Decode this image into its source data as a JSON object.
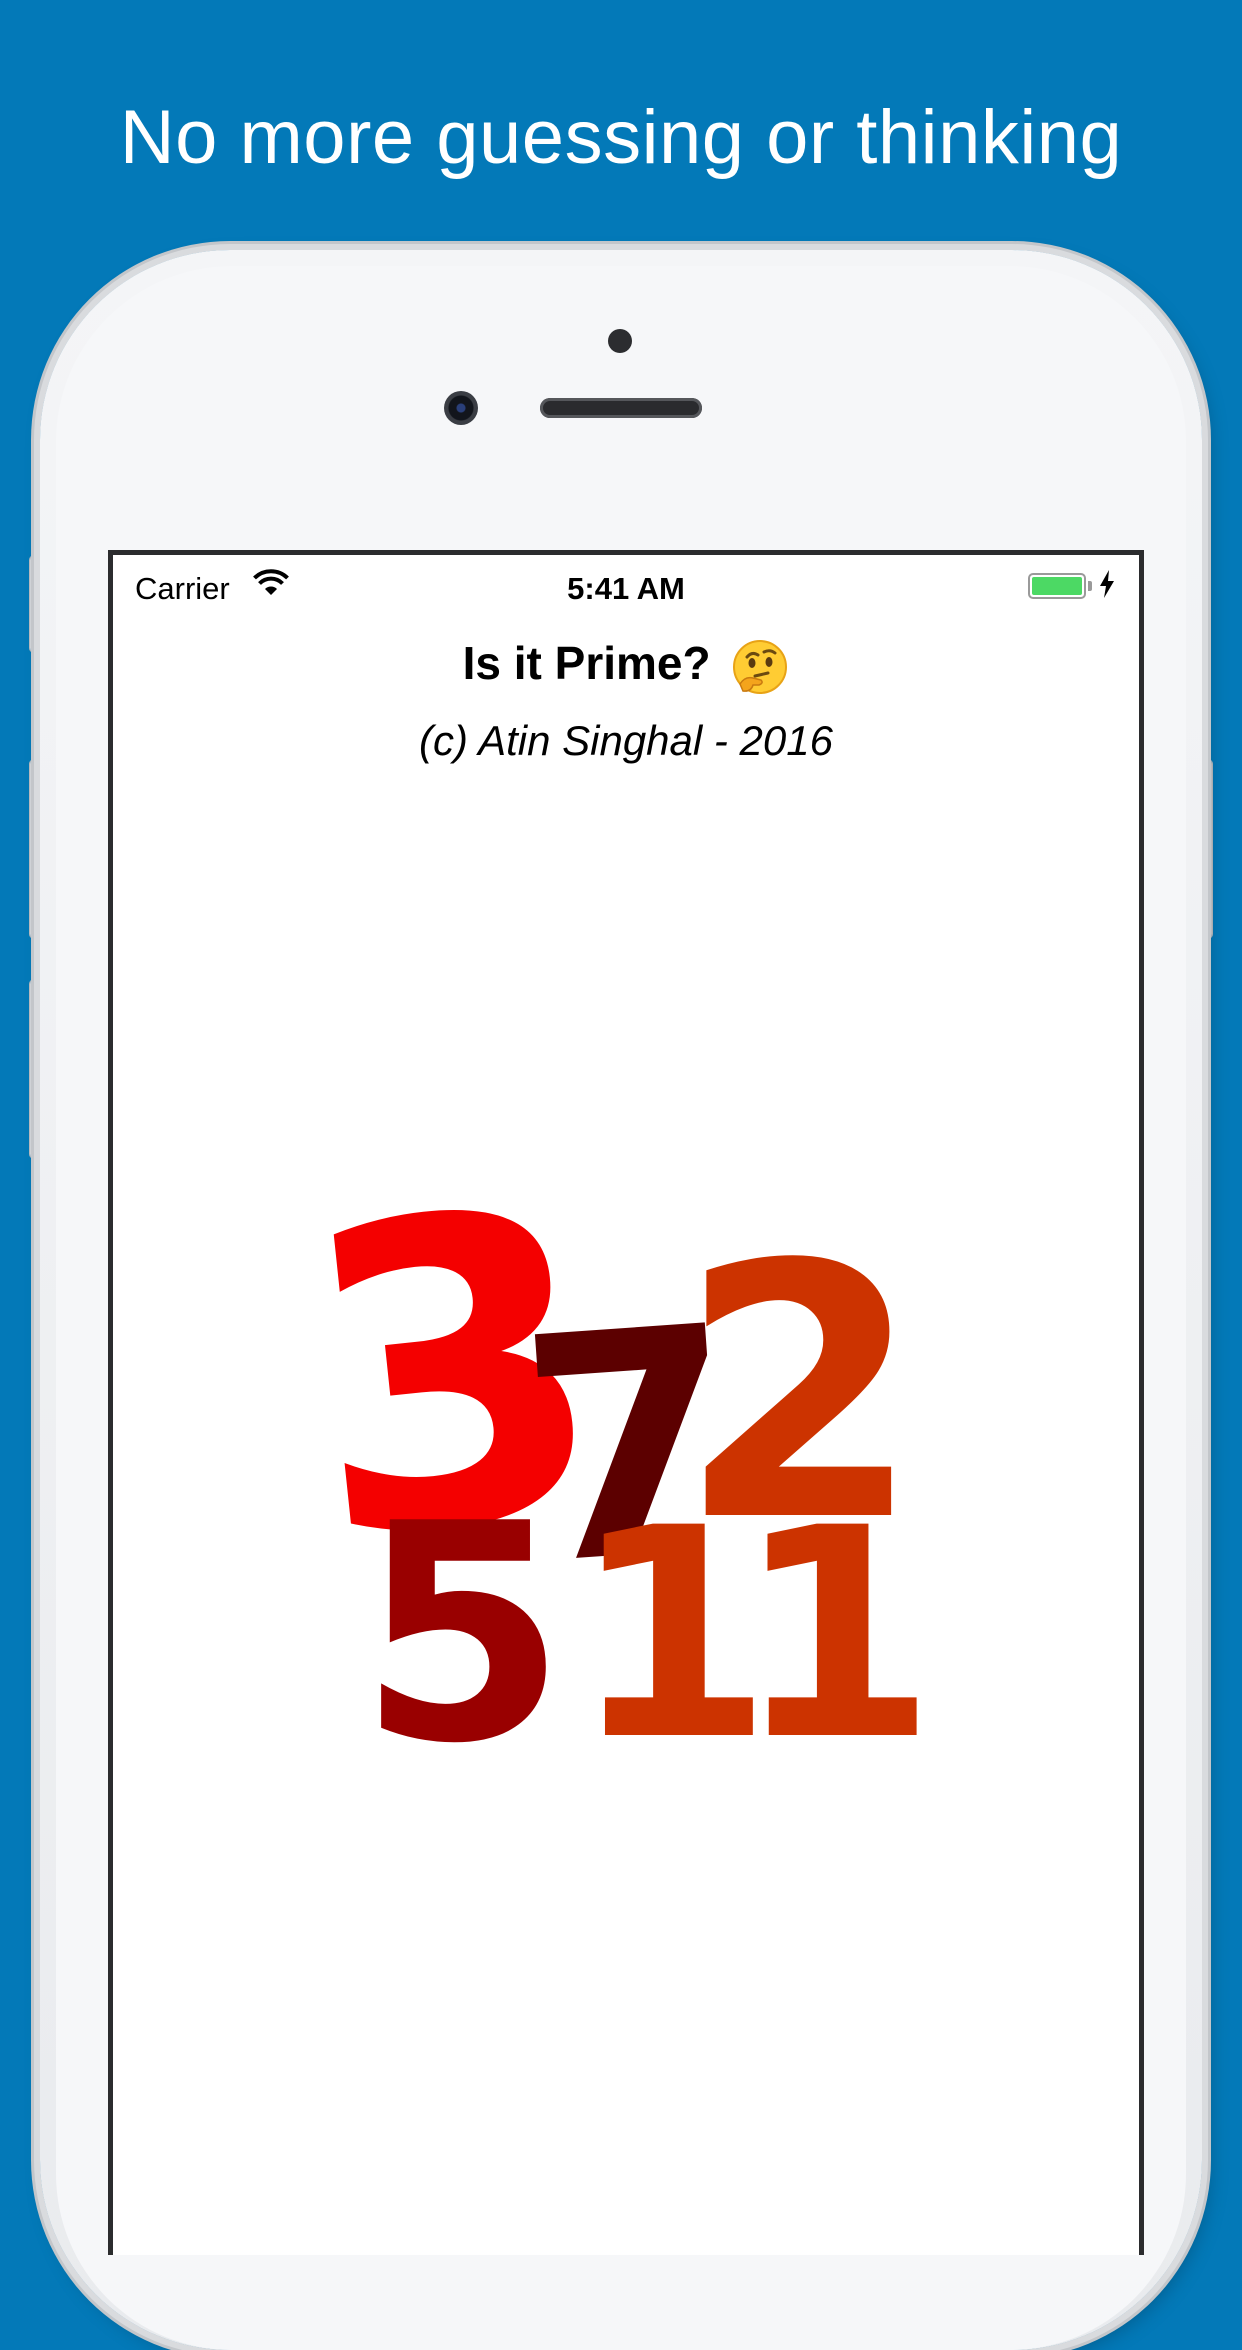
{
  "banner": {
    "headline": "No more guessing or thinking"
  },
  "status_bar": {
    "carrier": "Carrier",
    "time": "5:41 AM"
  },
  "app": {
    "title": "Is it Prime?",
    "title_emoji": "thinking-face-icon",
    "subtitle": "(c) Atin Singhal - 2016"
  },
  "logo": {
    "numbers": [
      {
        "text": "3",
        "color": "#f40000"
      },
      {
        "text": "2",
        "color": "#cc3300"
      },
      {
        "text": "7",
        "color": "#5c0000"
      },
      {
        "text": "5",
        "color": "#990000"
      },
      {
        "text": "11",
        "color": "#cc3300"
      }
    ]
  },
  "colors": {
    "background": "#0379b8",
    "battery": "#4cd964"
  }
}
